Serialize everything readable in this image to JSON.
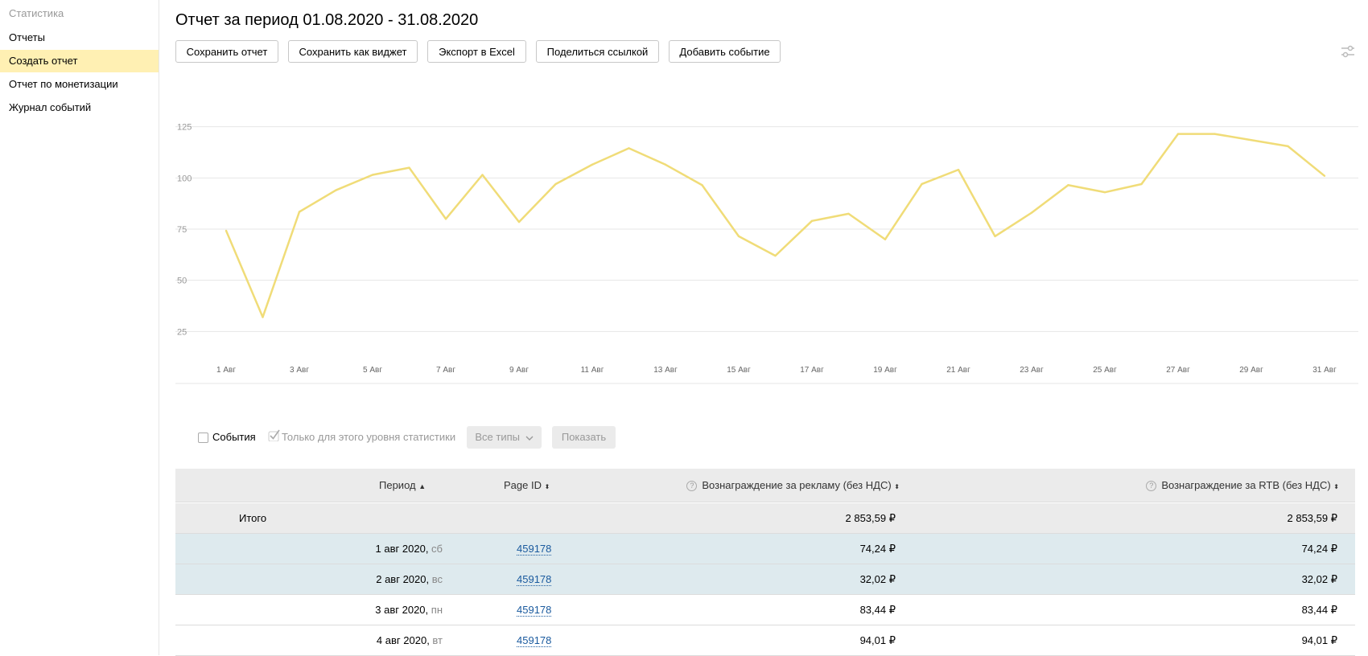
{
  "sidebar": {
    "title": "Статистика",
    "items": [
      {
        "label": "Отчеты",
        "active": false
      },
      {
        "label": "Создать отчет",
        "active": true
      },
      {
        "label": "Отчет по монетизации",
        "active": false
      },
      {
        "label": "Журнал событий",
        "active": false
      }
    ]
  },
  "header": {
    "title": "Отчет за период 01.08.2020 - 31.08.2020"
  },
  "toolbar": {
    "save_label": "Сохранить отчет",
    "save_widget_label": "Сохранить как виджет",
    "export_label": "Экспорт в Excel",
    "share_label": "Поделиться ссылкой",
    "add_event_label": "Добавить событие",
    "settings_icon": "sliders-icon"
  },
  "chart_data": {
    "type": "line",
    "color": "#f0dc78",
    "x": [
      "1 Авг",
      "2 Авг",
      "3 Авг",
      "4 Авг",
      "5 Авг",
      "6 Авг",
      "7 Авг",
      "8 Авг",
      "9 Авг",
      "10 Авг",
      "11 Авг",
      "12 Авг",
      "13 Авг",
      "14 Авг",
      "15 Авг",
      "16 Авг",
      "17 Авг",
      "18 Авг",
      "19 Авг",
      "20 Авг",
      "21 Авг",
      "22 Авг",
      "23 Авг",
      "24 Авг",
      "25 Авг",
      "26 Авг",
      "27 Авг",
      "28 Авг",
      "29 Авг",
      "30 Авг",
      "31 Авг"
    ],
    "tick_labels": [
      "1 Авг",
      "3 Авг",
      "5 Авг",
      "7 Авг",
      "9 Авг",
      "11 Авг",
      "13 Авг",
      "15 Авг",
      "17 Авг",
      "19 Авг",
      "21 Авг",
      "23 Авг",
      "25 Авг",
      "27 Авг",
      "29 Авг",
      "31 Авг"
    ],
    "values": [
      74.24,
      32.02,
      83.44,
      94.01,
      101.5,
      105,
      80,
      101.5,
      78.5,
      97,
      106.5,
      114.5,
      106.5,
      96.5,
      71.5,
      62,
      79,
      82.5,
      70,
      97,
      104,
      71.5,
      83,
      96.5,
      93,
      97,
      121.5,
      121.5,
      118.5,
      115.5,
      101
    ],
    "y_ticks": [
      25,
      50,
      75,
      100,
      125,
      150
    ],
    "ylim": [
      0,
      150
    ],
    "grid": true
  },
  "controls": {
    "events_label": "События",
    "events_checked": false,
    "level_label": "Только для этого уровня статистики",
    "level_checked": true,
    "types_label": "Все типы",
    "show_label": "Показать"
  },
  "table": {
    "columns": {
      "period": "Период",
      "page_id": "Page ID",
      "reward": "Вознаграждение за рекламу (без НДС)",
      "rtb": "Вознаграждение за RTB (без НДС)"
    },
    "total": {
      "label": "Итого",
      "reward": "2 853,59 ₽",
      "rtb": "2 853,59 ₽"
    },
    "rows": [
      {
        "date": "1 авг 2020",
        "weekday": "сб",
        "page_id": "459178",
        "reward": "74,24 ₽",
        "rtb": "74,24 ₽",
        "highlighted": true
      },
      {
        "date": "2 авг 2020",
        "weekday": "вс",
        "page_id": "459178",
        "reward": "32,02 ₽",
        "rtb": "32,02 ₽",
        "highlighted": true
      },
      {
        "date": "3 авг 2020",
        "weekday": "пн",
        "page_id": "459178",
        "reward": "83,44 ₽",
        "rtb": "83,44 ₽",
        "highlighted": false
      },
      {
        "date": "4 авг 2020",
        "weekday": "вт",
        "page_id": "459178",
        "reward": "94,01 ₽",
        "rtb": "94,01 ₽",
        "highlighted": false
      }
    ]
  }
}
